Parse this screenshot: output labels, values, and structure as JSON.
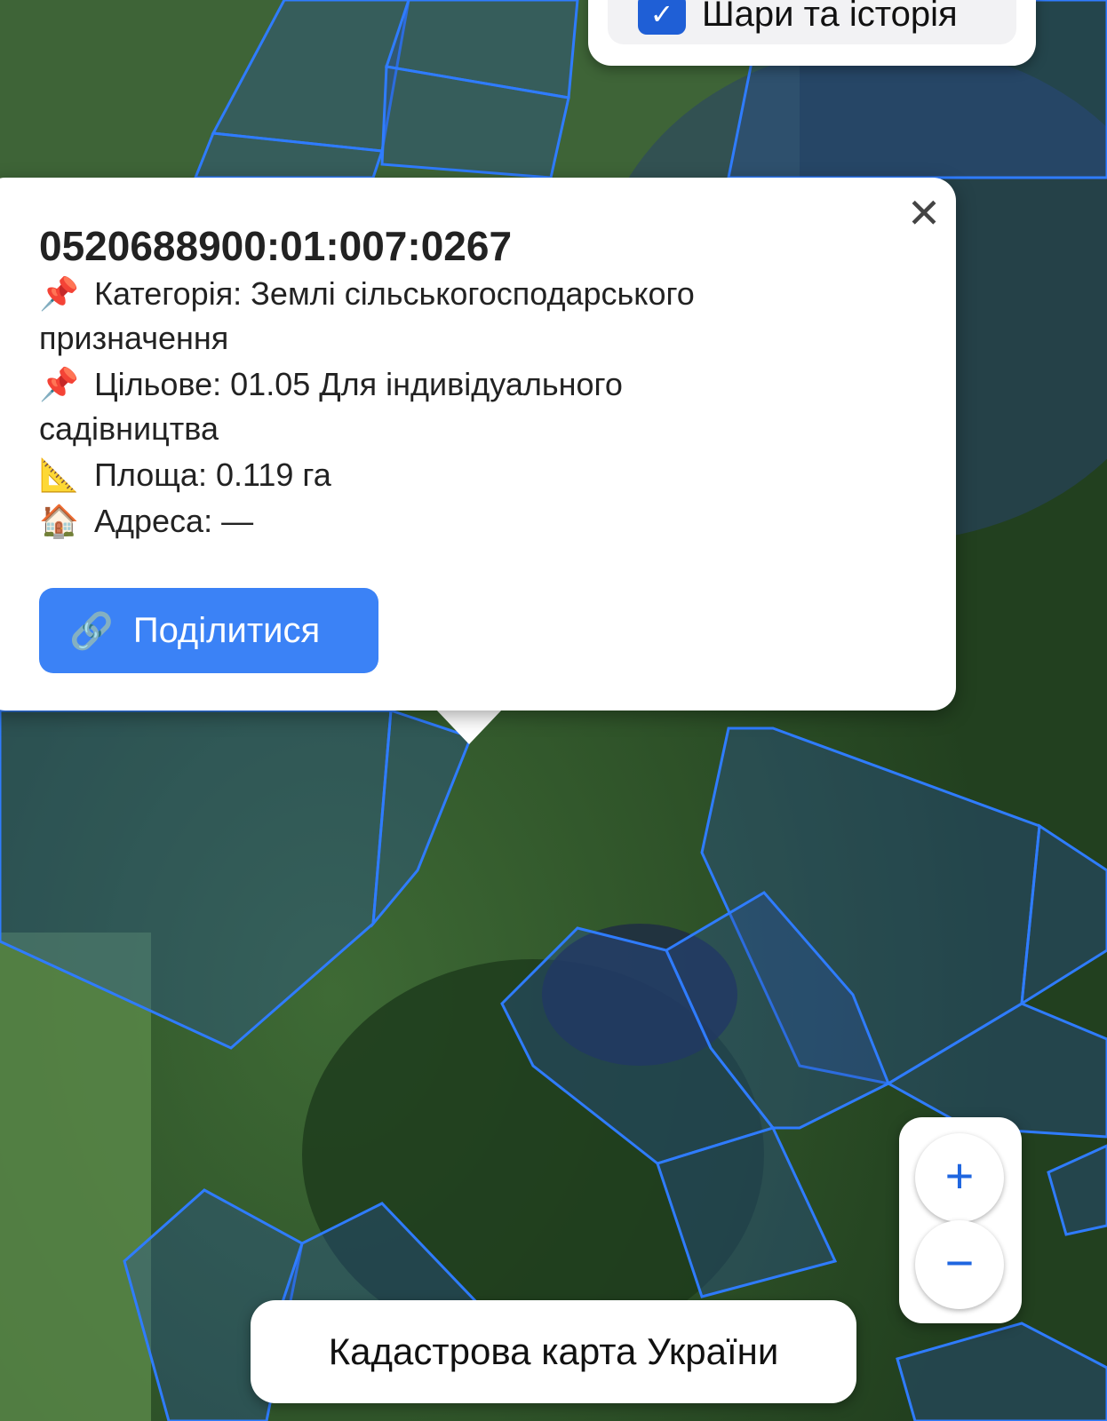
{
  "map": {
    "parcel_stroke": "#2f7cff",
    "parcel_fill": "rgba(40,80,160,0.35)"
  },
  "layers_panel": {
    "label": "Шари та історія",
    "icon": "checkbox-checked-icon",
    "checkmark": "✓"
  },
  "popup": {
    "close_symbol": "✕",
    "parcel_id": "0520688900:01:007:0267",
    "rows": [
      {
        "icon": "pushpin-icon",
        "glyph": "📌",
        "text": "Категорія: Землі сільськогосподарського"
      },
      {
        "icon": "",
        "glyph": "",
        "text": "призначення"
      },
      {
        "icon": "pushpin-icon",
        "glyph": "📌",
        "text": "Цільове: 01.05 Для індивідуального"
      },
      {
        "icon": "",
        "glyph": "",
        "text": "садівництва"
      },
      {
        "icon": "triangular-ruler-icon",
        "glyph": "📐",
        "text": "Площа: 0.119 га"
      },
      {
        "icon": "house-icon",
        "glyph": "🏠",
        "text": "Адреса: —"
      }
    ],
    "share_button": {
      "icon": "link-icon",
      "glyph": "🔗",
      "label": "Поділитися",
      "color": "#3b82f6"
    }
  },
  "zoom": {
    "plus": "+",
    "minus": "−",
    "accent": "#1f66e0"
  },
  "footer": {
    "label": "Кадастрова карта України"
  }
}
